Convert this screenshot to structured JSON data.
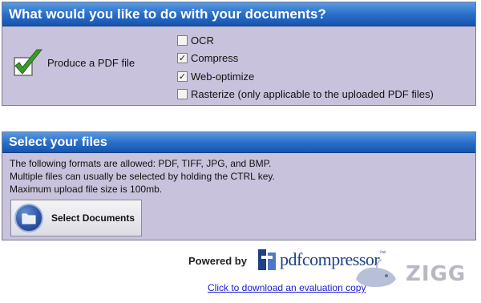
{
  "panel1": {
    "title": "What would you like to do with your documents?",
    "produce_label": "Produce a PDF file",
    "options": [
      {
        "label": "OCR",
        "checked": false
      },
      {
        "label": "Compress",
        "checked": true
      },
      {
        "label": "Web-optimize",
        "checked": true
      },
      {
        "label": "Rasterize (only applicable to the uploaded PDF files)",
        "checked": false
      }
    ]
  },
  "panel2": {
    "title": "Select your files",
    "info_lines": [
      "The following formats are allowed: PDF, TIFF, JPG, and BMP.",
      "Multiple files can usually be selected by holding the CTRL key.",
      "Maximum upload file size is 100mb."
    ],
    "select_button": "Select Documents"
  },
  "footer": {
    "powered_by": "Powered by",
    "logo_text": "pdfcompressor",
    "logo_tm": "™",
    "download_link": "Click to download an evaluation copy",
    "watermark": "ZIGG"
  },
  "colors": {
    "panel_bg": "#c9c2dc",
    "header_blue": "#2b6fc9",
    "check_green": "#3f9a2e",
    "link_blue": "#1a1ad6"
  },
  "icons": {
    "produce": "green-checkmark-icon",
    "select": "folder-icon",
    "logo": "pdfcompressor-logo-icon",
    "watermark": "whale-icon"
  }
}
